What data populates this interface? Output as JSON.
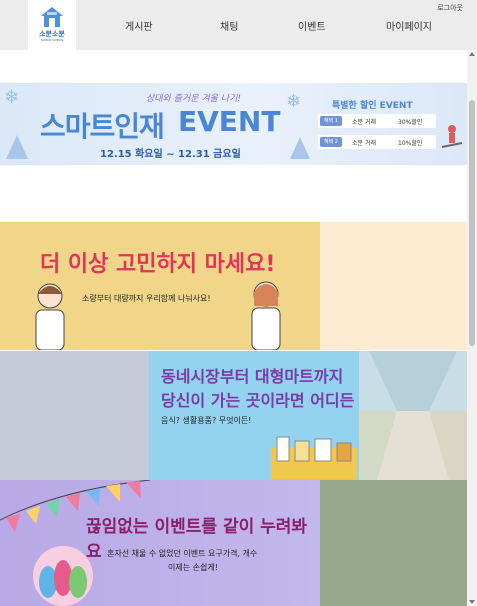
{
  "header": {
    "logo_text": "소분소분",
    "logo_subtext": "SOBUN SOBUN",
    "nav": [
      "게시판",
      "채팅",
      "이벤트",
      "마이페이지"
    ],
    "logout": "로그아웃"
  },
  "event_banner": {
    "subtitle": "상대와 즐거운 겨울 나기!",
    "title_main": "스마트인재",
    "title_event": "EVENT",
    "date": "12.15 화요일 ~ 12.31 금요일",
    "special": "특별한 할인 EVENT",
    "benefits": [
      {
        "tag": "혜택 1",
        "desc": "소분 거래",
        "discount": "30%할인"
      },
      {
        "tag": "혜택 2",
        "desc": "소분 거래",
        "discount": "10%할인"
      }
    ]
  },
  "banner2": {
    "title": "더 이상 고민하지 마세요!",
    "subtitle": "소량부터 대량까지 우리함께 나눠사요!"
  },
  "banner3": {
    "title_line1": "동네시장부터 대형마트까지",
    "title_line2": "당신이 가는 곳이라면 어디든",
    "subtitle": "음식? 생활용품? 무엇이든!"
  },
  "banner4": {
    "title": "끊임없는 이벤트를 같이 누려봐요",
    "subtitle_line1": "혼자선 채울 수 없었던 이벤트 요구가격, 개수",
    "subtitle_line2": "이제는 손쉽게!"
  },
  "colors": {
    "header_bg": "#ececec",
    "event_blue": "#4a86d6",
    "banner2_bg": "#f1d68a",
    "banner2_title": "#e0345a",
    "banner3_bg": "#93d3f0",
    "banner3_title": "#7b3aa8",
    "banner4_bg": "#b8a9e6",
    "banner4_title": "#8a1f6a"
  }
}
